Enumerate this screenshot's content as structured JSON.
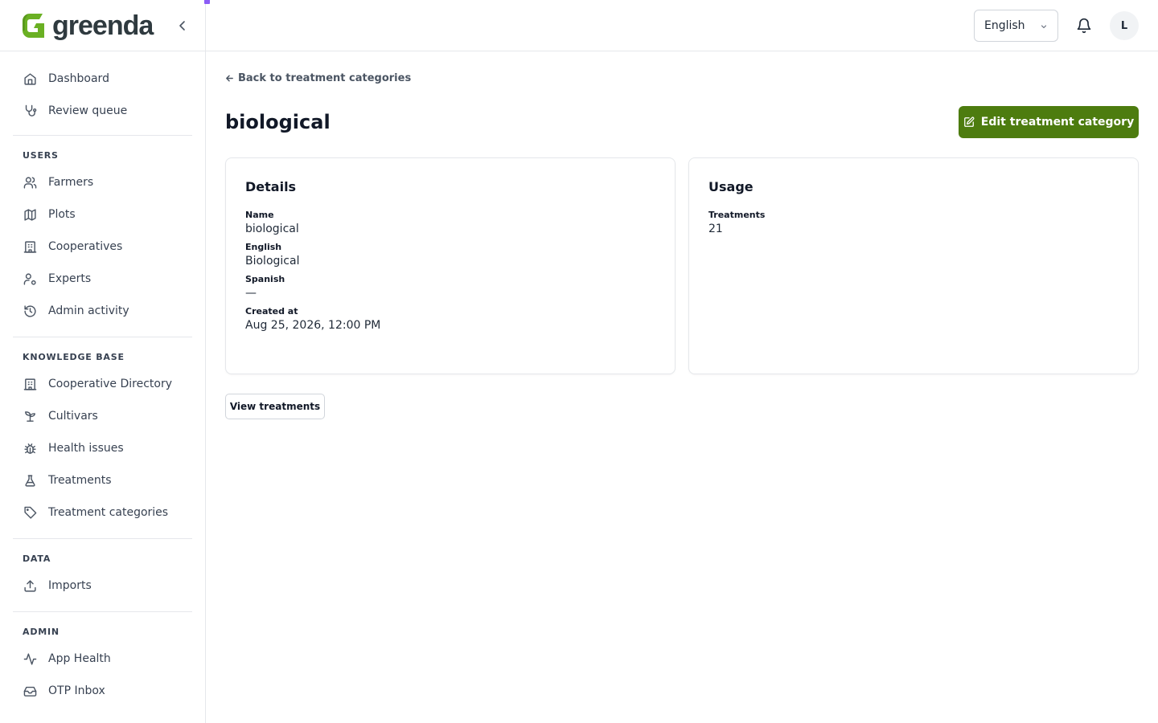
{
  "brand": {
    "name": "greenda",
    "accent": "#4d7c0f",
    "dot_color": "#8b5cf6"
  },
  "sidebar": {
    "collapse_icon": "chevron-left-icon",
    "main_items": [
      {
        "label": "Dashboard",
        "icon": "home-icon"
      },
      {
        "label": "Review queue",
        "icon": "stethoscope-icon"
      }
    ],
    "groups": [
      {
        "title": "USERS",
        "items": [
          {
            "label": "Farmers",
            "icon": "users-icon"
          },
          {
            "label": "Plots",
            "icon": "map-icon"
          },
          {
            "label": "Cooperatives",
            "icon": "building-icon"
          },
          {
            "label": "Experts",
            "icon": "user-cog-icon"
          },
          {
            "label": "Admin activity",
            "icon": "history-icon"
          }
        ]
      },
      {
        "title": "KNOWLEDGE BASE",
        "items": [
          {
            "label": "Cooperative Directory",
            "icon": "building-icon"
          },
          {
            "label": "Cultivars",
            "icon": "sprout-icon"
          },
          {
            "label": "Health issues",
            "icon": "bug-icon"
          },
          {
            "label": "Treatments",
            "icon": "flask-icon"
          },
          {
            "label": "Treatment categories",
            "icon": "tag-icon"
          }
        ]
      },
      {
        "title": "DATA",
        "items": [
          {
            "label": "Imports",
            "icon": "upload-icon"
          }
        ]
      },
      {
        "title": "ADMIN",
        "items": [
          {
            "label": "App Health",
            "icon": "activity-icon"
          },
          {
            "label": "OTP Inbox",
            "icon": "inbox-icon"
          }
        ]
      }
    ]
  },
  "topbar": {
    "language": "English",
    "avatar_initial": "L"
  },
  "page": {
    "back_link": "Back to treatment categories",
    "title": "biological",
    "edit_button": "Edit treatment category",
    "details": {
      "title": "Details",
      "fields": [
        {
          "label": "Name",
          "value": "biological"
        },
        {
          "label": "English",
          "value": "Biological"
        },
        {
          "label": "Spanish",
          "value": "—"
        },
        {
          "label": "Created at",
          "value": "Aug 25, 2026, 12:00 PM"
        }
      ]
    },
    "usage": {
      "title": "Usage",
      "fields": [
        {
          "label": "Treatments",
          "value": "21"
        }
      ]
    },
    "view_button": "View treatments"
  }
}
